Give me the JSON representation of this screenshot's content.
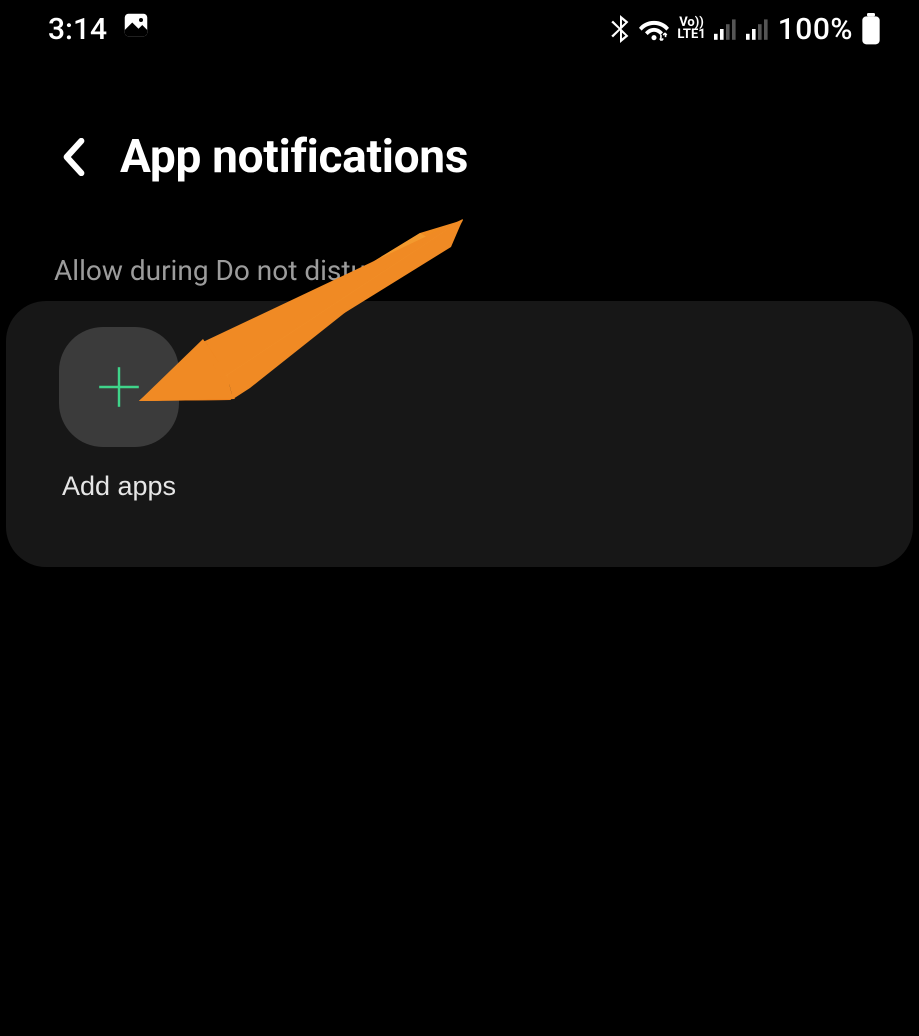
{
  "status": {
    "time": "3:14",
    "network_label": "LTE1",
    "battery": "100%"
  },
  "header": {
    "title": "App notifications"
  },
  "section": {
    "label": "Allow during Do not disturb"
  },
  "add_apps": {
    "label": "Add apps"
  },
  "colors": {
    "accent_plus": "#3fd48a",
    "arrow": "#f08a24"
  }
}
